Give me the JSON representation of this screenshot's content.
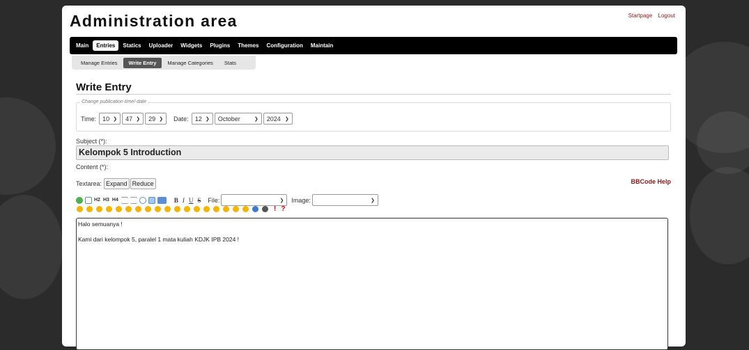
{
  "header": {
    "title": "Administration area",
    "links": [
      "Startpage",
      "Logout"
    ]
  },
  "main_nav": [
    "Main",
    "Entries",
    "Statics",
    "Uploader",
    "Widgets",
    "Plugins",
    "Themes",
    "Configuration",
    "Maintain"
  ],
  "main_nav_active": "Entries",
  "sub_nav": [
    "Manage Entries",
    "Write Entry",
    "Manage Categories",
    "Stats"
  ],
  "sub_nav_active": "Write Entry",
  "page_title": "Write Entry",
  "publication": {
    "legend": "Change publication time/-date",
    "time_label": "Time:",
    "hour": "10",
    "minute": "47",
    "second": "29",
    "date_label": "Date:",
    "day": "12",
    "month": "October",
    "year": "2024"
  },
  "subject": {
    "label": "Subject (*):",
    "value": "Kelompok 5 Introduction"
  },
  "content": {
    "label": "Content (*):",
    "textarea_label": "Textarea:",
    "expand_label": "Expand",
    "reduce_label": "Reduce",
    "bbcode_help": "BBCode Help",
    "file_label": "File:",
    "image_label": "Image:",
    "text_lines": [
      "Halo semuanya !",
      "",
      "Kami dari kelompok 5, paralel 1 mata kuliah KDJK IPB 2024 !"
    ]
  },
  "toolbar_icons": [
    "globe-icon",
    "email-icon",
    "h2-icon",
    "h3-icon",
    "h4-icon",
    "unordered-list-icon",
    "ordered-list-icon",
    "quote-icon",
    "image-icon",
    "code-icon",
    "bold-icon",
    "italic-icon",
    "underline-icon",
    "strikethrough-icon"
  ],
  "toolbar_text": {
    "h2": "H2",
    "h3": "H3",
    "h4": "H4",
    "bold": "B",
    "italic": "I",
    "underline": "U",
    "strike": "S"
  },
  "smiley_count": 20,
  "smiley_extra": {
    "exclaim": "!",
    "question": "?"
  },
  "colors": {
    "accent": "#8b1a1a",
    "nav_bg": "#000000",
    "subnav_bg": "#e6e6e6"
  }
}
